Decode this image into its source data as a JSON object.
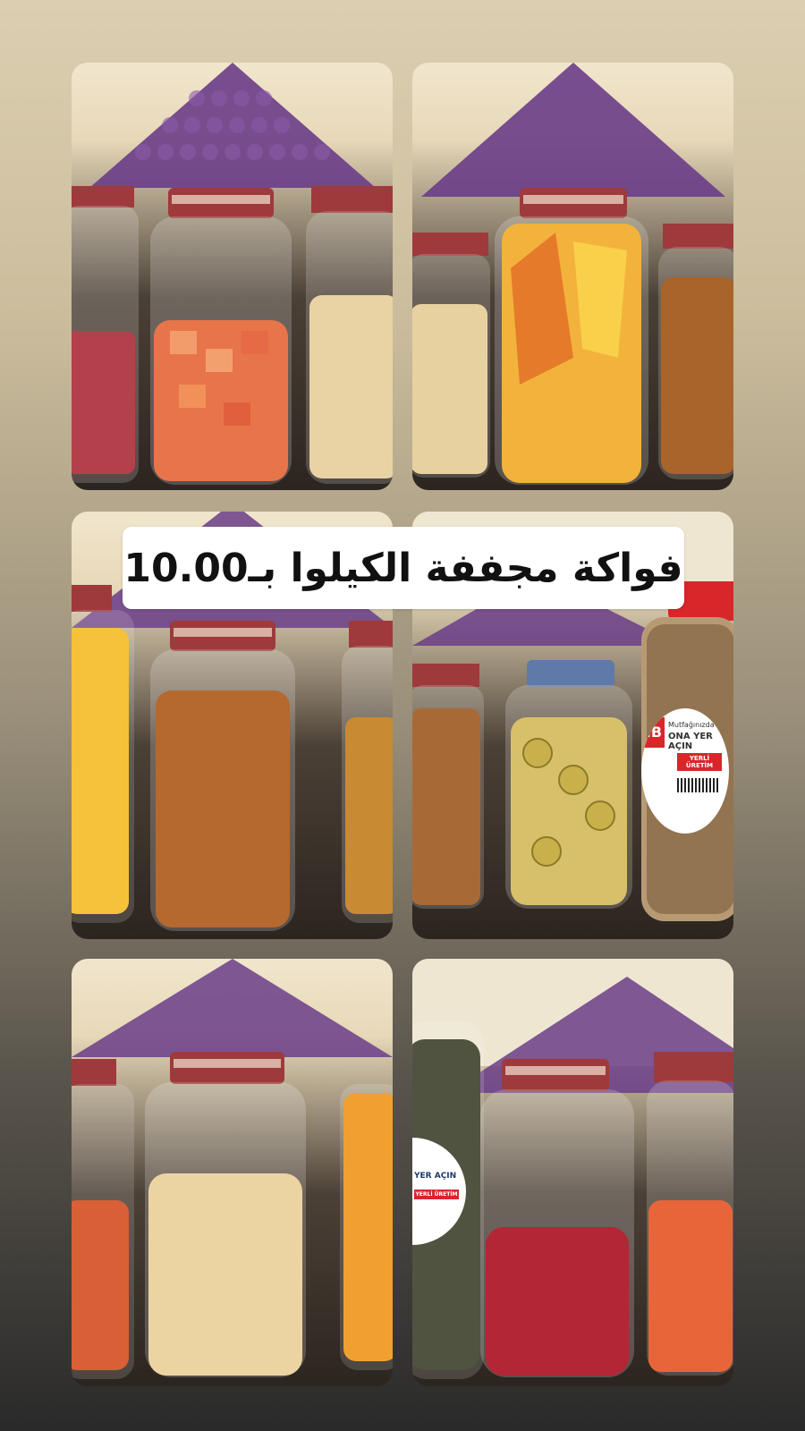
{
  "caption": {
    "text": "فواكة مجففة الكيلوا بـ10.00"
  },
  "jar_labels": {
    "brand": "IB",
    "line1": "Mutfağınızda",
    "line2": "ONA YER AÇIN",
    "badge": "YERLİ ÜRETİM",
    "bottom_line": "YER AÇIN",
    "bottom_badge": "YERLİ ÜRETİM"
  },
  "colors": {
    "background_top": "#dccfb1",
    "background_bottom": "#2a2a2a",
    "caption_bg": "#ffffff",
    "purple_display": "#6d3f8c",
    "lid_red": "#a3333a"
  },
  "photos": [
    {
      "id": "photo-1",
      "contents": [
        "dried-strawberry",
        "dried-papaya",
        "coconut-chips"
      ]
    },
    {
      "id": "photo-2",
      "contents": [
        "coconut-chips",
        "dried-mango",
        "dried-fig"
      ]
    },
    {
      "id": "photo-3",
      "contents": [
        "dried-mango",
        "dried-fig",
        "dried-banana"
      ]
    },
    {
      "id": "photo-4",
      "contents": [
        "dried-fig",
        "dried-kiwi",
        "brazil-nuts"
      ]
    },
    {
      "id": "photo-5",
      "contents": [
        "dried-papaya",
        "coconut-chips",
        "dried-mango"
      ]
    },
    {
      "id": "photo-6",
      "contents": [
        "pumpkin-seeds",
        "dried-strawberry",
        "dried-papaya"
      ]
    }
  ]
}
